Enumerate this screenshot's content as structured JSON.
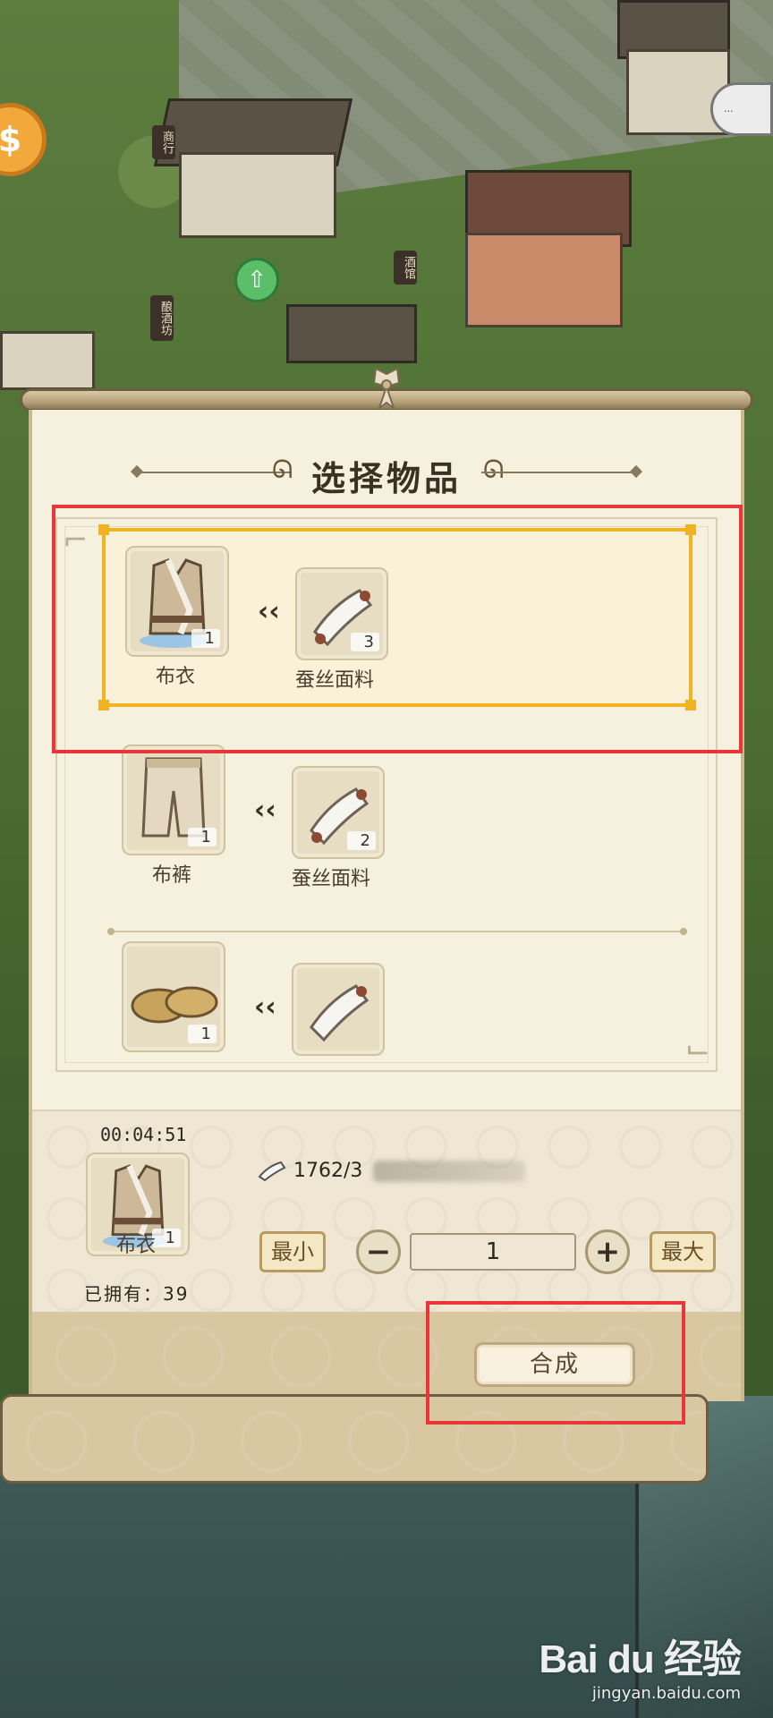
{
  "dialog": {
    "title": "选择物品"
  },
  "recipes": [
    {
      "output": {
        "name": "布衣",
        "count": "1",
        "icon": "vest-icon"
      },
      "material": {
        "name": "蚕丝面料",
        "count": "3",
        "icon": "silk-cloth-icon"
      },
      "selected": true
    },
    {
      "output": {
        "name": "布裤",
        "count": "1",
        "icon": "trousers-icon"
      },
      "material": {
        "name": "蚕丝面料",
        "count": "2",
        "icon": "silk-cloth-icon"
      },
      "selected": false
    },
    {
      "output": {
        "name": "",
        "count": "1",
        "icon": "straw-sandals-icon"
      },
      "material": {
        "name": "",
        "count": "",
        "icon": "silk-cloth-icon"
      },
      "selected": false
    }
  ],
  "detail": {
    "timer": "00:04:51",
    "item_name": "布衣",
    "item_count": "1",
    "owned": "已拥有：39",
    "material_progress": "1762/3",
    "min_label": "最小",
    "max_label": "最大",
    "minus_label": "−",
    "plus_label": "+",
    "quantity": "1"
  },
  "action": {
    "compose_label": "合成"
  },
  "map": {
    "signs": [
      "商行",
      "酒馆",
      "酿酒坊"
    ],
    "coin_glyph": "$"
  },
  "watermark": {
    "logo": "Bai du 经验",
    "url": "jingyan.baidu.com"
  },
  "colors": {
    "highlight": "#e8363a",
    "selection": "#f0b323",
    "panel": "#f6f1de"
  }
}
